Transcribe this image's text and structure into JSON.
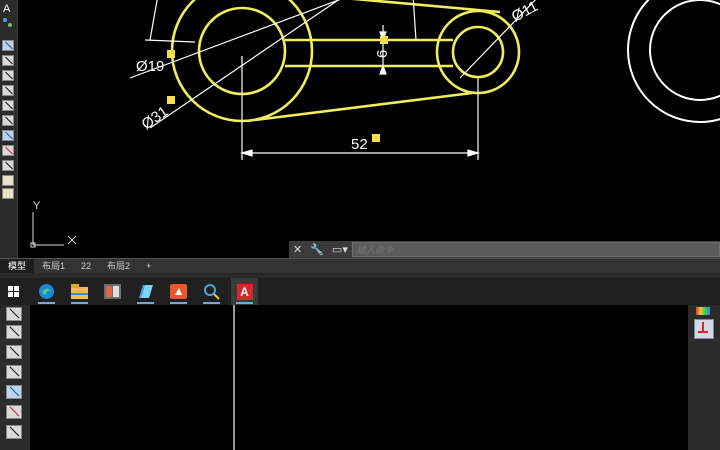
{
  "drawing": {
    "dim_phi19": "Ø19",
    "dim_phi31": "Ø31",
    "dim_phi11": "Ø11",
    "dim_6": "6",
    "dim_52": "52",
    "ucs_y": "Y",
    "ucs_x": "X",
    "colors": {
      "geometry": "#f2ee5a",
      "dims": "#ffffff",
      "marker": "#f4e04d"
    }
  },
  "command": {
    "placeholder": "键入命令"
  },
  "layout_tabs": [
    "模型",
    "布局1",
    "22",
    "布局2",
    "+"
  ],
  "taskbar": {
    "apps": [
      "windows-start-icon",
      "edge-icon",
      "file-explorer-icon",
      "app-icon",
      "notepad-icon",
      "presentation-icon",
      "search-app-icon",
      "autocad-icon"
    ],
    "autocad_label": "A"
  },
  "toolbar": {
    "top_letter": "A"
  }
}
